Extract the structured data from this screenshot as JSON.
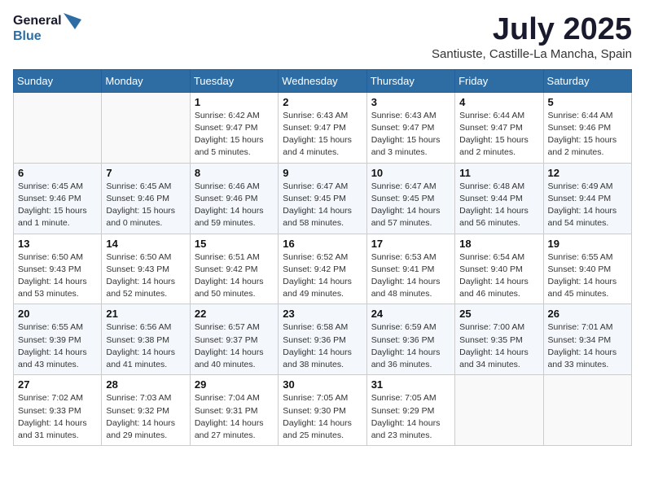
{
  "header": {
    "logo_line1": "General",
    "logo_line2": "Blue",
    "month": "July 2025",
    "location": "Santiuste, Castille-La Mancha, Spain"
  },
  "weekdays": [
    "Sunday",
    "Monday",
    "Tuesday",
    "Wednesday",
    "Thursday",
    "Friday",
    "Saturday"
  ],
  "weeks": [
    [
      {
        "day": "",
        "info": ""
      },
      {
        "day": "",
        "info": ""
      },
      {
        "day": "1",
        "info": "Sunrise: 6:42 AM\nSunset: 9:47 PM\nDaylight: 15 hours and 5 minutes."
      },
      {
        "day": "2",
        "info": "Sunrise: 6:43 AM\nSunset: 9:47 PM\nDaylight: 15 hours and 4 minutes."
      },
      {
        "day": "3",
        "info": "Sunrise: 6:43 AM\nSunset: 9:47 PM\nDaylight: 15 hours and 3 minutes."
      },
      {
        "day": "4",
        "info": "Sunrise: 6:44 AM\nSunset: 9:47 PM\nDaylight: 15 hours and 2 minutes."
      },
      {
        "day": "5",
        "info": "Sunrise: 6:44 AM\nSunset: 9:46 PM\nDaylight: 15 hours and 2 minutes."
      }
    ],
    [
      {
        "day": "6",
        "info": "Sunrise: 6:45 AM\nSunset: 9:46 PM\nDaylight: 15 hours and 1 minute."
      },
      {
        "day": "7",
        "info": "Sunrise: 6:45 AM\nSunset: 9:46 PM\nDaylight: 15 hours and 0 minutes."
      },
      {
        "day": "8",
        "info": "Sunrise: 6:46 AM\nSunset: 9:46 PM\nDaylight: 14 hours and 59 minutes."
      },
      {
        "day": "9",
        "info": "Sunrise: 6:47 AM\nSunset: 9:45 PM\nDaylight: 14 hours and 58 minutes."
      },
      {
        "day": "10",
        "info": "Sunrise: 6:47 AM\nSunset: 9:45 PM\nDaylight: 14 hours and 57 minutes."
      },
      {
        "day": "11",
        "info": "Sunrise: 6:48 AM\nSunset: 9:44 PM\nDaylight: 14 hours and 56 minutes."
      },
      {
        "day": "12",
        "info": "Sunrise: 6:49 AM\nSunset: 9:44 PM\nDaylight: 14 hours and 54 minutes."
      }
    ],
    [
      {
        "day": "13",
        "info": "Sunrise: 6:50 AM\nSunset: 9:43 PM\nDaylight: 14 hours and 53 minutes."
      },
      {
        "day": "14",
        "info": "Sunrise: 6:50 AM\nSunset: 9:43 PM\nDaylight: 14 hours and 52 minutes."
      },
      {
        "day": "15",
        "info": "Sunrise: 6:51 AM\nSunset: 9:42 PM\nDaylight: 14 hours and 50 minutes."
      },
      {
        "day": "16",
        "info": "Sunrise: 6:52 AM\nSunset: 9:42 PM\nDaylight: 14 hours and 49 minutes."
      },
      {
        "day": "17",
        "info": "Sunrise: 6:53 AM\nSunset: 9:41 PM\nDaylight: 14 hours and 48 minutes."
      },
      {
        "day": "18",
        "info": "Sunrise: 6:54 AM\nSunset: 9:40 PM\nDaylight: 14 hours and 46 minutes."
      },
      {
        "day": "19",
        "info": "Sunrise: 6:55 AM\nSunset: 9:40 PM\nDaylight: 14 hours and 45 minutes."
      }
    ],
    [
      {
        "day": "20",
        "info": "Sunrise: 6:55 AM\nSunset: 9:39 PM\nDaylight: 14 hours and 43 minutes."
      },
      {
        "day": "21",
        "info": "Sunrise: 6:56 AM\nSunset: 9:38 PM\nDaylight: 14 hours and 41 minutes."
      },
      {
        "day": "22",
        "info": "Sunrise: 6:57 AM\nSunset: 9:37 PM\nDaylight: 14 hours and 40 minutes."
      },
      {
        "day": "23",
        "info": "Sunrise: 6:58 AM\nSunset: 9:36 PM\nDaylight: 14 hours and 38 minutes."
      },
      {
        "day": "24",
        "info": "Sunrise: 6:59 AM\nSunset: 9:36 PM\nDaylight: 14 hours and 36 minutes."
      },
      {
        "day": "25",
        "info": "Sunrise: 7:00 AM\nSunset: 9:35 PM\nDaylight: 14 hours and 34 minutes."
      },
      {
        "day": "26",
        "info": "Sunrise: 7:01 AM\nSunset: 9:34 PM\nDaylight: 14 hours and 33 minutes."
      }
    ],
    [
      {
        "day": "27",
        "info": "Sunrise: 7:02 AM\nSunset: 9:33 PM\nDaylight: 14 hours and 31 minutes."
      },
      {
        "day": "28",
        "info": "Sunrise: 7:03 AM\nSunset: 9:32 PM\nDaylight: 14 hours and 29 minutes."
      },
      {
        "day": "29",
        "info": "Sunrise: 7:04 AM\nSunset: 9:31 PM\nDaylight: 14 hours and 27 minutes."
      },
      {
        "day": "30",
        "info": "Sunrise: 7:05 AM\nSunset: 9:30 PM\nDaylight: 14 hours and 25 minutes."
      },
      {
        "day": "31",
        "info": "Sunrise: 7:05 AM\nSunset: 9:29 PM\nDaylight: 14 hours and 23 minutes."
      },
      {
        "day": "",
        "info": ""
      },
      {
        "day": "",
        "info": ""
      }
    ]
  ]
}
